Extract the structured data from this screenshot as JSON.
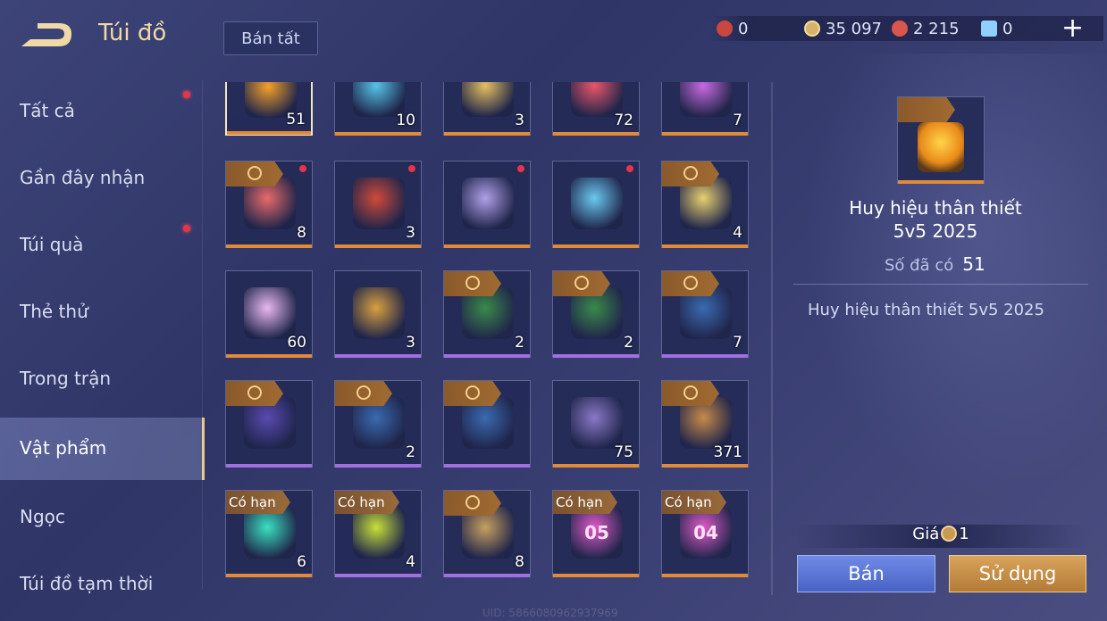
{
  "header": {
    "title": "Túi đồ",
    "sell_all": "Bán tất"
  },
  "currencies": [
    {
      "name": "red-gem",
      "value": "0",
      "color": "#c9473f"
    },
    {
      "name": "gold-coin",
      "value": "35 097",
      "color": "#d6b36a"
    },
    {
      "name": "ruby",
      "value": "2 215",
      "color": "#d8564e"
    },
    {
      "name": "crystal",
      "value": "0",
      "color": "#8fd0ff"
    }
  ],
  "sidebar": {
    "items": [
      {
        "label": "Tất cả",
        "dot": true
      },
      {
        "label": "Gần đây nhận",
        "dot": false
      },
      {
        "label": "Túi quà",
        "dot": true
      },
      {
        "label": "Thẻ thử",
        "dot": false
      },
      {
        "label": "Trong trận",
        "dot": false
      },
      {
        "label": "Vật phẩm",
        "dot": false,
        "active": true
      },
      {
        "label": "Ngọc",
        "dot": false
      },
      {
        "label": "Túi đồ tạm thời",
        "dot": false
      }
    ]
  },
  "grid": {
    "rows": [
      [
        {
          "count": "51",
          "tag": false,
          "bar": "#e08a3a",
          "art": "#f4a12a",
          "sel": true
        },
        {
          "count": "10",
          "tag": false,
          "bar": "#e08a3a",
          "art": "#56c4e8"
        },
        {
          "count": "3",
          "tag": false,
          "bar": "#e08a3a",
          "art": "#e5c060"
        },
        {
          "count": "72",
          "tag": false,
          "bar": "#e08a3a",
          "art": "#e8566a"
        },
        {
          "count": "7",
          "tag": false,
          "bar": "#e08a3a",
          "art": "#c86ae0"
        }
      ],
      [
        {
          "count": "8",
          "tag": true,
          "bar": "#e08a3a",
          "art": "#e86a6a",
          "dot": true
        },
        {
          "count": "3",
          "tag": false,
          "bar": "#e08a3a",
          "art": "#d04a3a",
          "dot": true
        },
        {
          "count": "",
          "tag": false,
          "bar": "#e08a3a",
          "art": "#b0a0e8",
          "dot": true
        },
        {
          "count": "",
          "tag": false,
          "bar": "#e08a3a",
          "art": "#6ac8f0",
          "dot": true
        },
        {
          "count": "4",
          "tag": true,
          "bar": "#e08a3a",
          "art": "#e8d070"
        }
      ],
      [
        {
          "count": "60",
          "tag": false,
          "bar": "#e08a3a",
          "art": "#e8b8f0"
        },
        {
          "count": "3",
          "tag": false,
          "bar": "#a070e0",
          "art": "#d8a040"
        },
        {
          "count": "2",
          "tag": true,
          "bar": "#a070e0",
          "art": "#3a8a4a"
        },
        {
          "count": "2",
          "tag": true,
          "bar": "#a070e0",
          "art": "#3a8a4a"
        },
        {
          "count": "7",
          "tag": true,
          "bar": "#a070e0",
          "art": "#3a6ab0"
        }
      ],
      [
        {
          "count": "",
          "tag": true,
          "bar": "#a070e0",
          "art": "#5a4ab0"
        },
        {
          "count": "2",
          "tag": true,
          "bar": "#a070e0",
          "art": "#3a6ab0"
        },
        {
          "count": "",
          "tag": true,
          "bar": "#a070e0",
          "art": "#3a6ab0"
        },
        {
          "count": "75",
          "tag": false,
          "bar": "#e08a3a",
          "art": "#8a78c8"
        },
        {
          "count": "371",
          "tag": true,
          "bar": "#e08a3a",
          "art": "#c88a4a"
        }
      ],
      [
        {
          "count": "6",
          "limited": "Có hạn",
          "bar": "#e08a3a",
          "art": "#3ae0c0"
        },
        {
          "count": "4",
          "limited": "Có hạn",
          "bar": "#a070e0",
          "art": "#c8e03a"
        },
        {
          "count": "8",
          "tag": true,
          "bar": "#a070e0",
          "art": "#c8a060"
        },
        {
          "count": "",
          "limited": "Có hạn",
          "bar": "#e08a3a",
          "art": "#e05ac8",
          "label": "05"
        },
        {
          "count": "",
          "limited": "Có hạn",
          "bar": "#e08a3a",
          "art": "#e05ac8",
          "label": "04"
        }
      ]
    ]
  },
  "detail": {
    "name_line1": "Huy hiệu thân thiết",
    "name_line2": "5v5 2025",
    "owned_label": "Số đã có",
    "owned_value": "51",
    "description": "Huy hiệu thân thiết 5v5 2025",
    "price_label": "Giá",
    "price_value": "1",
    "sell_button": "Bán",
    "use_button": "Sử dụng"
  },
  "uid": "UID: 5866080962937969"
}
